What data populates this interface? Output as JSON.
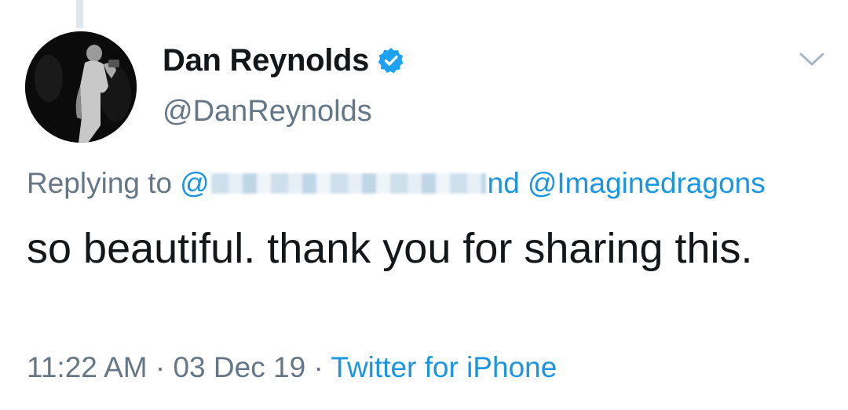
{
  "tweet": {
    "author": {
      "display_name": "Dan Reynolds",
      "handle": "@DanReynolds",
      "verified": true,
      "verified_icon": "verified-badge-icon",
      "avatar_icon": "avatar-photo"
    },
    "caret_icon": "chevron-down-icon",
    "reply": {
      "prefix": "Replying to",
      "first_mention_start": "@",
      "first_mention_end": "nd",
      "second_mention": "@Imaginedragons"
    },
    "text": "so beautiful. thank you for sharing this.",
    "meta": {
      "time": "11:22 AM",
      "separator": "·",
      "date": "03 Dec 19",
      "source": "Twitter for iPhone"
    }
  },
  "colors": {
    "text_primary": "#14171a",
    "text_secondary": "#657786",
    "link": "#1b95e0",
    "verified": "#1da1f2",
    "thread_line": "#e1e8ed"
  }
}
